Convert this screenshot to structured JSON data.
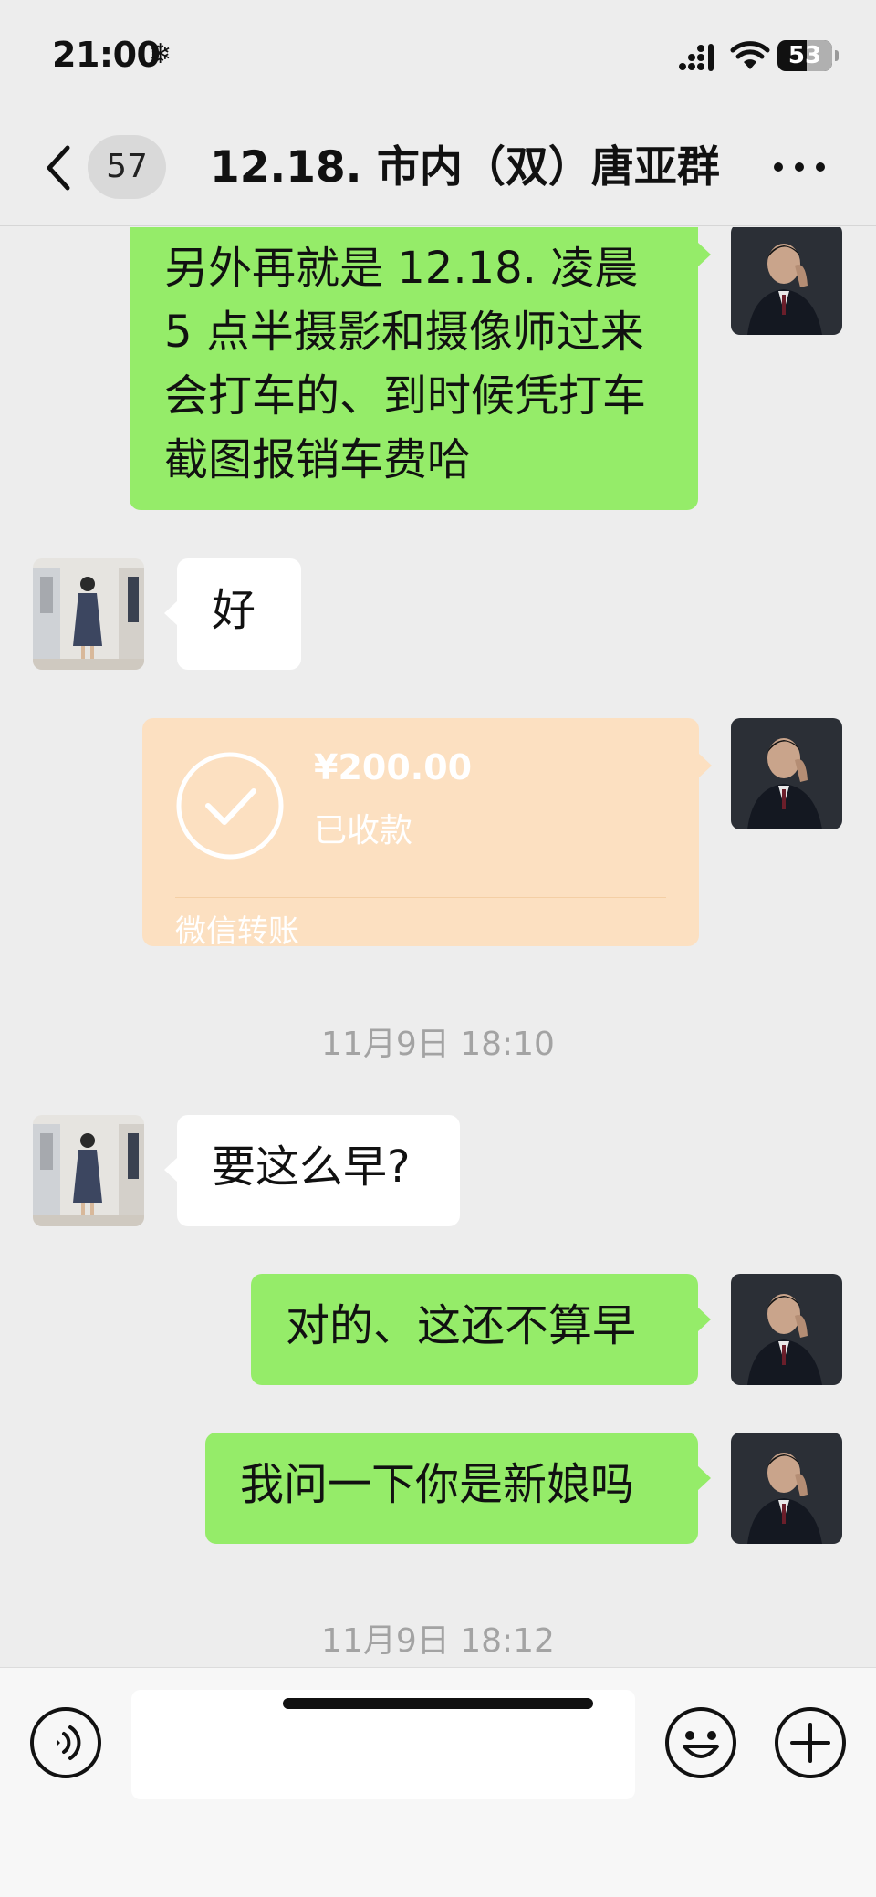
{
  "status_bar": {
    "time": "21:00",
    "time_icon": "snowflake-icon",
    "battery": "53",
    "battery_percent": 53
  },
  "nav": {
    "back_icon": "chevron-left-icon",
    "unread_count": "57",
    "title": "12.18. 市内（双）唐亚群",
    "more_icon": "more-dots-icon"
  },
  "messages": [
    {
      "side": "right",
      "type": "text",
      "text": "另外再就是 12.18. 凌晨 5 点半摄影和摄像师过来会打车的、到时候凭打车截图报销车费哈"
    },
    {
      "side": "left",
      "type": "text",
      "text": "好"
    },
    {
      "side": "right",
      "type": "transfer",
      "amount": "¥200.00",
      "status": "已收款",
      "label": "微信转账"
    },
    {
      "type": "time",
      "text": "11月9日 18:10"
    },
    {
      "side": "left",
      "type": "text",
      "text": "要这么早?"
    },
    {
      "side": "right",
      "type": "text",
      "text": "对的、这还不算早"
    },
    {
      "side": "right",
      "type": "text",
      "text": "我问一下你是新娘吗"
    },
    {
      "type": "time",
      "text": "11月9日 18:12"
    }
  ],
  "input_bar": {
    "voice_icon": "voice-icon",
    "input_value": "",
    "emoji_icon": "emoji-icon",
    "plus_icon": "plus-icon"
  },
  "colors": {
    "background": "#ededed",
    "bubble_sent": "#95ec69",
    "bubble_received": "#ffffff",
    "transfer_received": "#fce0c1"
  }
}
